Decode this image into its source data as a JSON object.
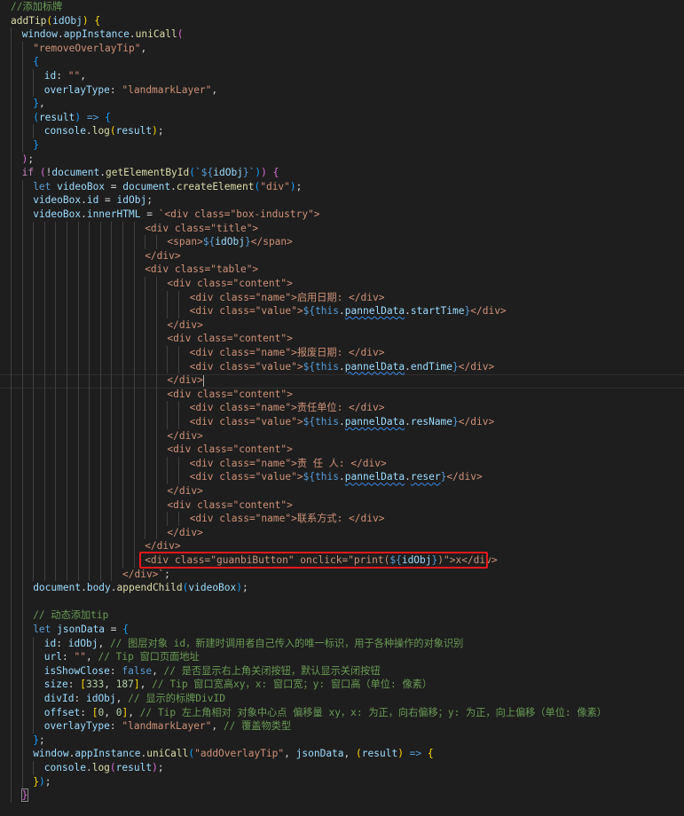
{
  "colors": {
    "background": "#1e1e1e",
    "comment": "#6a9955",
    "keyword_control": "#c586c0",
    "keyword": "#569cd6",
    "function": "#dcdcaa",
    "variable": "#9cdcfe",
    "constant": "#4fc1ff",
    "string": "#ce9178",
    "number": "#b5cea8",
    "class": "#4ec9b0",
    "text": "#d4d4d4",
    "bracket1": "#ffd700",
    "bracket2": "#da70d6",
    "bracket3": "#179fff",
    "tag": "#808080",
    "tag_name": "#569cd6",
    "attr_name": "#9cdcfe",
    "interp": "#569cd6",
    "highlight_box": "#e8191a"
  },
  "lines": [
    {
      "i": 0,
      "t": [
        [
          "//添加标牌",
          "comment"
        ]
      ]
    },
    {
      "i": 0,
      "t": [
        [
          "addTip",
          "function"
        ],
        [
          "(",
          "bracket1"
        ],
        [
          "idObj",
          "variable"
        ],
        [
          ")",
          "bracket1"
        ],
        [
          " ",
          "text"
        ],
        [
          "{",
          "bracket1"
        ]
      ]
    },
    {
      "i": 1,
      "t": [
        [
          "window",
          "variable"
        ],
        [
          ".",
          "text"
        ],
        [
          "appInstance",
          "variable"
        ],
        [
          ".",
          "text"
        ],
        [
          "uniCall",
          "function"
        ],
        [
          "(",
          "bracket2"
        ]
      ]
    },
    {
      "i": 2,
      "t": [
        [
          "\"removeOverlayTip\"",
          "string"
        ],
        [
          ",",
          "text"
        ]
      ]
    },
    {
      "i": 2,
      "t": [
        [
          "{",
          "bracket3"
        ]
      ]
    },
    {
      "i": 3,
      "t": [
        [
          "id",
          "variable"
        ],
        [
          ": ",
          "text"
        ],
        [
          "\"\"",
          "string"
        ],
        [
          ",",
          "text"
        ]
      ]
    },
    {
      "i": 3,
      "t": [
        [
          "overlayType",
          "variable"
        ],
        [
          ": ",
          "text"
        ],
        [
          "\"landmarkLayer\"",
          "string"
        ],
        [
          ",",
          "text"
        ]
      ]
    },
    {
      "i": 2,
      "t": [
        [
          "}",
          "bracket3"
        ],
        [
          ",",
          "text"
        ]
      ]
    },
    {
      "i": 2,
      "t": [
        [
          "(",
          "bracket3"
        ],
        [
          "result",
          "variable"
        ],
        [
          ")",
          "bracket3"
        ],
        [
          " => ",
          "keyword"
        ],
        [
          "{",
          "bracket3"
        ]
      ]
    },
    {
      "i": 3,
      "t": [
        [
          "console",
          "variable"
        ],
        [
          ".",
          "text"
        ],
        [
          "log",
          "function"
        ],
        [
          "(",
          "bracket1"
        ],
        [
          "result",
          "variable"
        ],
        [
          ")",
          "bracket1"
        ],
        [
          ";",
          "text"
        ]
      ]
    },
    {
      "i": 2,
      "t": [
        [
          "}",
          "bracket3"
        ]
      ]
    },
    {
      "i": 1,
      "t": [
        [
          ")",
          "bracket2"
        ],
        [
          ";",
          "text"
        ]
      ]
    },
    {
      "i": 1,
      "t": [
        [
          "if",
          "keyword_control"
        ],
        [
          " ",
          "text"
        ],
        [
          "(",
          "bracket2"
        ],
        [
          "!",
          "text"
        ],
        [
          "document",
          "variable"
        ],
        [
          ".",
          "text"
        ],
        [
          "getElementById",
          "function"
        ],
        [
          "(",
          "bracket3"
        ],
        [
          "`${",
          "interp"
        ],
        [
          "idObj",
          "variable"
        ],
        [
          "}`",
          "interp"
        ],
        [
          ")",
          "bracket3"
        ],
        [
          ")",
          "bracket2"
        ],
        [
          " ",
          "text"
        ],
        [
          "{",
          "bracket2"
        ]
      ]
    },
    {
      "i": 2,
      "t": [
        [
          "let",
          "keyword"
        ],
        [
          " ",
          "text"
        ],
        [
          "videoBox",
          "variable"
        ],
        [
          " = ",
          "text"
        ],
        [
          "document",
          "variable"
        ],
        [
          ".",
          "text"
        ],
        [
          "createElement",
          "function"
        ],
        [
          "(",
          "bracket3"
        ],
        [
          "\"div\"",
          "string"
        ],
        [
          ")",
          "bracket3"
        ],
        [
          ";",
          "text"
        ]
      ]
    },
    {
      "i": 2,
      "t": [
        [
          "videoBox",
          "variable"
        ],
        [
          ".",
          "text"
        ],
        [
          "id",
          "variable"
        ],
        [
          " = ",
          "text"
        ],
        [
          "idObj",
          "variable"
        ],
        [
          ";",
          "text"
        ]
      ]
    },
    {
      "i": 2,
      "t": [
        [
          "videoBox",
          "variable"
        ],
        [
          ".",
          "text"
        ],
        [
          "innerHTML",
          "variable"
        ],
        [
          " = ",
          "text"
        ],
        [
          "`<div class=\"box-industry\">",
          "string"
        ]
      ]
    },
    {
      "i": 12,
      "t": [
        [
          "<div class=\"title\">",
          "string"
        ]
      ]
    },
    {
      "i": 14,
      "t": [
        [
          "<span>",
          "string"
        ],
        [
          "${",
          "interp"
        ],
        [
          "idObj",
          "variable"
        ],
        [
          "}",
          "interp"
        ],
        [
          "</span>",
          "string"
        ]
      ]
    },
    {
      "i": 12,
      "t": [
        [
          "</div>",
          "string"
        ]
      ]
    },
    {
      "i": 12,
      "t": [
        [
          "<div class=\"table\">",
          "string"
        ]
      ]
    },
    {
      "i": 14,
      "t": [
        [
          "<div class=\"content\">",
          "string"
        ]
      ]
    },
    {
      "i": 16,
      "t": [
        [
          "<div class=\"name\">启用日期: </div>",
          "string"
        ]
      ]
    },
    {
      "i": 16,
      "t": [
        [
          "<div class=\"value\">",
          "string"
        ],
        [
          "${",
          "interp"
        ],
        [
          "this",
          "keyword"
        ],
        [
          ".",
          "text"
        ],
        [
          "pannelData",
          "variable",
          "squig"
        ],
        [
          ".",
          "text"
        ],
        [
          "startTime",
          "variable"
        ],
        [
          "}",
          "interp"
        ],
        [
          "</div>",
          "string"
        ]
      ]
    },
    {
      "i": 14,
      "t": [
        [
          "</div>",
          "string"
        ]
      ]
    },
    {
      "i": 14,
      "t": [
        [
          "<div class=\"content\">",
          "string"
        ]
      ]
    },
    {
      "i": 16,
      "t": [
        [
          "<div class=\"name\">报废日期: </div>",
          "string"
        ]
      ]
    },
    {
      "i": 16,
      "t": [
        [
          "<div class=\"value\">",
          "string"
        ],
        [
          "${",
          "interp"
        ],
        [
          "this",
          "keyword"
        ],
        [
          ".",
          "text"
        ],
        [
          "pannelData",
          "variable",
          "squig"
        ],
        [
          ".",
          "text"
        ],
        [
          "endTime",
          "variable"
        ],
        [
          "}",
          "interp"
        ],
        [
          "</div>",
          "string"
        ]
      ]
    },
    {
      "i": 14,
      "t": [
        [
          "</div>",
          "string"
        ]
      ],
      "cursor": true
    },
    {
      "i": 14,
      "t": [
        [
          "<div class=\"content\">",
          "string"
        ]
      ]
    },
    {
      "i": 16,
      "t": [
        [
          "<div class=\"name\">责任单位: </div>",
          "string"
        ]
      ]
    },
    {
      "i": 16,
      "t": [
        [
          "<div class=\"value\">",
          "string"
        ],
        [
          "${",
          "interp"
        ],
        [
          "this",
          "keyword"
        ],
        [
          ".",
          "text"
        ],
        [
          "pannelData",
          "variable",
          "squig"
        ],
        [
          ".",
          "text"
        ],
        [
          "resName",
          "variable"
        ],
        [
          "}",
          "interp"
        ],
        [
          "</div>",
          "string"
        ]
      ]
    },
    {
      "i": 14,
      "t": [
        [
          "</div>",
          "string"
        ]
      ]
    },
    {
      "i": 14,
      "t": [
        [
          "<div class=\"content\">",
          "string"
        ]
      ]
    },
    {
      "i": 16,
      "t": [
        [
          "<div class=\"name\">责 任 人: </div>",
          "string"
        ]
      ]
    },
    {
      "i": 16,
      "t": [
        [
          "<div class=\"value\">",
          "string"
        ],
        [
          "${",
          "interp"
        ],
        [
          "this",
          "keyword"
        ],
        [
          ".",
          "text"
        ],
        [
          "pannelData",
          "variable",
          "squig"
        ],
        [
          ".",
          "text"
        ],
        [
          "reser",
          "variable",
          "squig"
        ],
        [
          "}",
          "interp"
        ],
        [
          "</div>",
          "string"
        ]
      ]
    },
    {
      "i": 14,
      "t": [
        [
          "</div>",
          "string"
        ]
      ]
    },
    {
      "i": 14,
      "t": [
        [
          "<div class=\"content\">",
          "string"
        ]
      ]
    },
    {
      "i": 16,
      "t": [
        [
          "<div class=\"name\">联系方式: </div>",
          "string"
        ]
      ]
    },
    {
      "i": 14,
      "t": [
        [
          "</div>",
          "string"
        ]
      ]
    },
    {
      "i": 12,
      "t": [
        [
          "</div>",
          "string"
        ]
      ]
    },
    {
      "i": 12,
      "t": [
        [
          "<div class=\"guanbiButton\" onclick=\"print(",
          "string"
        ],
        [
          "${",
          "interp"
        ],
        [
          "idObj",
          "variable"
        ],
        [
          "}",
          "interp"
        ],
        [
          ")\">x</div>",
          "string"
        ]
      ]
    },
    {
      "i": 10,
      "t": [
        [
          "</div>`",
          "string"
        ],
        [
          ";",
          "text"
        ]
      ]
    },
    {
      "i": 2,
      "t": [
        [
          "document",
          "variable"
        ],
        [
          ".",
          "text"
        ],
        [
          "body",
          "variable"
        ],
        [
          ".",
          "text"
        ],
        [
          "appendChild",
          "function"
        ],
        [
          "(",
          "bracket3"
        ],
        [
          "videoBox",
          "variable"
        ],
        [
          ")",
          "bracket3"
        ],
        [
          ";",
          "text"
        ]
      ]
    },
    {
      "i": 2,
      "t": []
    },
    {
      "i": 2,
      "t": [
        [
          "// 动态添加tip",
          "comment"
        ]
      ]
    },
    {
      "i": 2,
      "t": [
        [
          "let",
          "keyword"
        ],
        [
          " ",
          "text"
        ],
        [
          "jsonData",
          "variable"
        ],
        [
          " = ",
          "text"
        ],
        [
          "{",
          "bracket3"
        ]
      ]
    },
    {
      "i": 3,
      "t": [
        [
          "id",
          "variable"
        ],
        [
          ": ",
          "text"
        ],
        [
          "idObj",
          "variable"
        ],
        [
          ", ",
          "text"
        ],
        [
          "// 图层对象 id，新建时调用者自己传入的唯一标识，用于各种操作的对象识别",
          "comment"
        ]
      ]
    },
    {
      "i": 3,
      "t": [
        [
          "url",
          "variable"
        ],
        [
          ": ",
          "text"
        ],
        [
          "\"\"",
          "string"
        ],
        [
          ", ",
          "text"
        ],
        [
          "// Tip 窗口页面地址",
          "comment"
        ]
      ]
    },
    {
      "i": 3,
      "t": [
        [
          "isShowClose",
          "variable"
        ],
        [
          ": ",
          "text"
        ],
        [
          "false",
          "keyword"
        ],
        [
          ", ",
          "text"
        ],
        [
          "// 是否显示右上角关闭按钮，默认显示关闭按钮",
          "comment"
        ]
      ]
    },
    {
      "i": 3,
      "t": [
        [
          "size",
          "variable"
        ],
        [
          ": ",
          "text"
        ],
        [
          "[",
          "bracket1"
        ],
        [
          "333",
          "number"
        ],
        [
          ", ",
          "text"
        ],
        [
          "187",
          "number"
        ],
        [
          "]",
          "bracket1"
        ],
        [
          ", ",
          "text"
        ],
        [
          "// Tip 窗口宽高xy，x: 窗口宽；y: 窗口高（单位: 像素）",
          "comment"
        ]
      ]
    },
    {
      "i": 3,
      "t": [
        [
          "divId",
          "variable"
        ],
        [
          ": ",
          "text"
        ],
        [
          "idObj",
          "variable"
        ],
        [
          ", ",
          "text"
        ],
        [
          "// 显示的标牌DivID",
          "comment"
        ]
      ]
    },
    {
      "i": 3,
      "t": [
        [
          "offset",
          "variable"
        ],
        [
          ": ",
          "text"
        ],
        [
          "[",
          "bracket1"
        ],
        [
          "0",
          "number"
        ],
        [
          ", ",
          "text"
        ],
        [
          "0",
          "number"
        ],
        [
          "]",
          "bracket1"
        ],
        [
          ", ",
          "text"
        ],
        [
          "// Tip 左上角相对 对象中心点 偏移量 xy，x: 为正，向右偏移；y: 为正，向上偏移（单位: 像素）",
          "comment"
        ]
      ]
    },
    {
      "i": 3,
      "t": [
        [
          "overlayType",
          "variable"
        ],
        [
          ": ",
          "text"
        ],
        [
          "\"landmarkLayer\"",
          "string"
        ],
        [
          ", ",
          "text"
        ],
        [
          "// 覆盖物类型",
          "comment"
        ]
      ]
    },
    {
      "i": 2,
      "t": [
        [
          "}",
          "bracket3"
        ],
        [
          ";",
          "text"
        ]
      ]
    },
    {
      "i": 2,
      "t": [
        [
          "window",
          "variable"
        ],
        [
          ".",
          "text"
        ],
        [
          "appInstance",
          "variable"
        ],
        [
          ".",
          "text"
        ],
        [
          "uniCall",
          "function"
        ],
        [
          "(",
          "bracket3"
        ],
        [
          "\"addOverlayTip\"",
          "string"
        ],
        [
          ", ",
          "text"
        ],
        [
          "jsonData",
          "variable"
        ],
        [
          ", ",
          "text"
        ],
        [
          "(",
          "bracket1"
        ],
        [
          "result",
          "variable"
        ],
        [
          ")",
          "bracket1"
        ],
        [
          " => ",
          "keyword"
        ],
        [
          "{",
          "bracket1"
        ]
      ]
    },
    {
      "i": 3,
      "t": [
        [
          "console",
          "variable"
        ],
        [
          ".",
          "text"
        ],
        [
          "log",
          "function"
        ],
        [
          "(",
          "bracket2"
        ],
        [
          "result",
          "variable"
        ],
        [
          ")",
          "bracket2"
        ],
        [
          ";",
          "text"
        ]
      ]
    },
    {
      "i": 2,
      "t": [
        [
          "}",
          "bracket1"
        ],
        [
          ")",
          "bracket3"
        ],
        [
          ";",
          "text"
        ]
      ]
    },
    {
      "i": 1,
      "t": [
        [
          "}",
          "bracket2"
        ]
      ],
      "boxed": true
    },
    {
      "i": 0,
      "t": [
        [
          "},",
          "text"
        ]
      ]
    }
  ]
}
